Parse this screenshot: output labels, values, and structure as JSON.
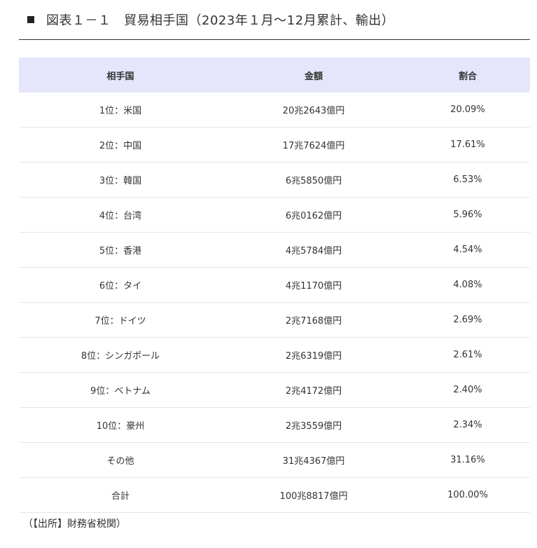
{
  "heading": {
    "title": "図表１－１　貿易相手国（2023年１月～12月累計、輸出）"
  },
  "table": {
    "headers": [
      "相手国",
      "金額",
      "割合"
    ],
    "rows": [
      [
        "1位：米国",
        "20兆2643億円",
        "20.09%"
      ],
      [
        "2位：中国",
        "17兆7624億円",
        "17.61%"
      ],
      [
        "3位：韓国",
        "6兆5850億円",
        "6.53%"
      ],
      [
        "4位：台湾",
        "6兆0162億円",
        "5.96%"
      ],
      [
        "5位：香港",
        "4兆5784億円",
        "4.54%"
      ],
      [
        "6位：タイ",
        "4兆1170億円",
        "4.08%"
      ],
      [
        "7位：ドイツ",
        "2兆7168億円",
        "2.69%"
      ],
      [
        "8位：シンガポール",
        "2兆6319億円",
        "2.61%"
      ],
      [
        "9位：ベトナム",
        "2兆4172億円",
        "2.40%"
      ],
      [
        "10位：豪州",
        "2兆3559億円",
        "2.34%"
      ],
      [
        "その他",
        "31兆4367億円",
        "31.16%"
      ],
      [
        "合計",
        "100兆8817億円",
        "100.00%"
      ]
    ]
  },
  "source": "（【出所】財務省税関）"
}
